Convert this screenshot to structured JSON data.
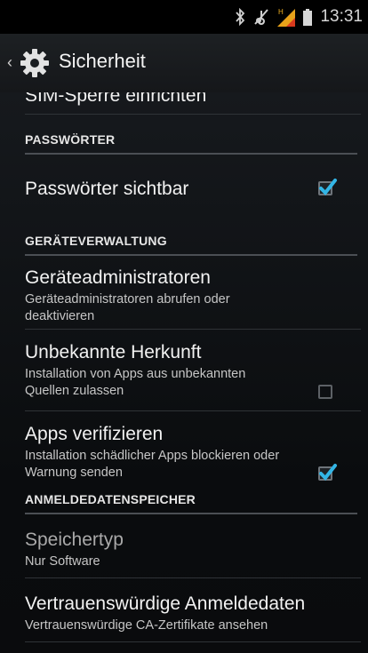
{
  "status_bar": {
    "time": "13:31",
    "icons": [
      "bluetooth-icon",
      "mute-icon",
      "signal-icon",
      "battery-icon"
    ]
  },
  "action_bar": {
    "title": "Sicherheit",
    "icon": "gear-icon"
  },
  "list": {
    "partial_title": "SIM-Sperre einrichten",
    "section_passwords": "PASSWÖRTER",
    "show_passwords_title": "Passwörter sichtbar",
    "show_passwords_checked": true,
    "section_device_admin": "GERÄTEVERWALTUNG",
    "device_admins_title": "Geräteadministratoren",
    "device_admins_summary": "Geräteadministratoren abrufen oder deaktivieren",
    "unknown_sources_title": "Unbekannte Herkunft",
    "unknown_sources_summary": "Installation von Apps aus unbekannten Quellen zulassen",
    "unknown_sources_checked": false,
    "verify_apps_title": "Apps verifizieren",
    "verify_apps_summary": "Installation schädlicher Apps blockieren oder Warnung senden",
    "verify_apps_checked": true,
    "section_credential_storage": "ANMELDEDATENSPEICHER",
    "storage_type_title": "Speichertyp",
    "storage_type_summary": "Nur Software",
    "trusted_credentials_title": "Vertrauenswürdige Anmeldedaten",
    "trusted_credentials_summary": "Vertrauenswürdige CA-Zertifikate ansehen"
  },
  "colors": {
    "accent_check": "#33b5e5",
    "signal_warning": "#f0b020",
    "signal_alert": "#e03020"
  }
}
